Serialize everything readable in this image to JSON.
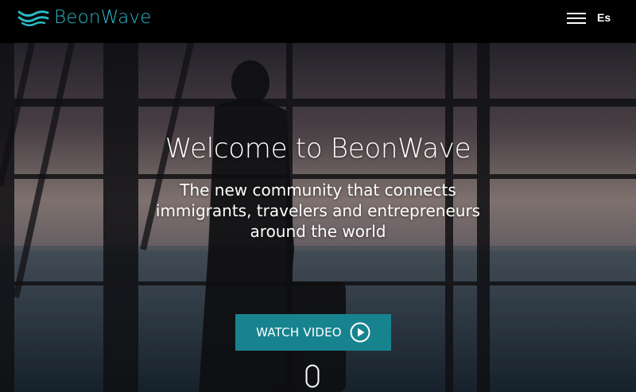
{
  "header": {
    "brand": "BeonWave",
    "language": "Es",
    "logo_icon": "wave-logo-icon",
    "menu_icon": "hamburger-menu-icon"
  },
  "hero": {
    "title": "Welcome to BeonWave",
    "subtitle_lines": [
      "The new community that connects",
      "immigrants, travelers and entrepreneurs",
      "around the world"
    ],
    "watch_button": "WATCH VIDEO",
    "play_icon": "play-circle-icon",
    "scroll_icon": "scroll-down-mouse-icon"
  },
  "colors": {
    "brand_accent": "#2eb8c6",
    "button_bg": "#17838f",
    "header_bg": "#000000"
  }
}
